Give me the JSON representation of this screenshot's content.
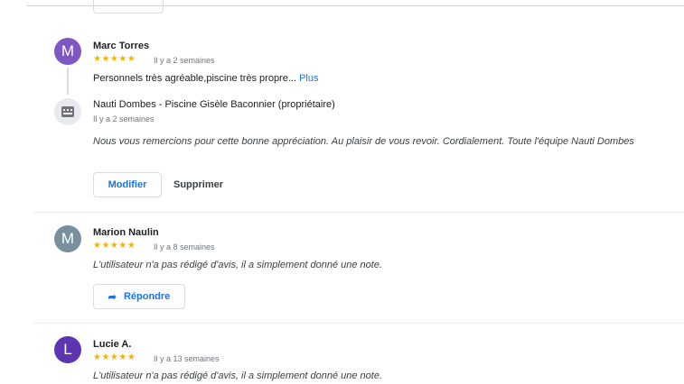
{
  "reviews": [
    {
      "initial": "M",
      "avatar_color": "#7e57c2",
      "name": "Marc Torres",
      "stars": "★★★★★",
      "age": "Il y a 2 semaines",
      "text": "Personnels très agréable,piscine très propre...",
      "more_label": "Plus",
      "owner_reply": {
        "name": "Nauti Dombes - Piscine Gisèle Baconnier (propriétaire)",
        "age": "Il y a 2 semaines",
        "text": "Nous vous remercions pour cette bonne appréciation. Au plaisir de vous revoir. Cordialement. Toute l'équipe Nauti Dombes"
      },
      "edit_label": "Modifier",
      "delete_label": "Supprimer"
    },
    {
      "initial": "M",
      "avatar_color": "#78909c",
      "name": "Marion Naulin",
      "stars": "★★★★★",
      "age": "Il y a 8 semaines",
      "text": "L'utilisateur n'a pas rédigé d'avis, il a simplement donné une note.",
      "reply_label": "Répondre"
    },
    {
      "initial": "L",
      "avatar_color": "#5e35b1",
      "name": "Lucie A.",
      "stars": "★★★★★",
      "age": "Il y a 13 semaines",
      "text": "L'utilisateur n'a pas rédigé d'avis, il a simplement donné une note."
    }
  ],
  "colors": {
    "accent": "#1a73e8",
    "star": "#f4b400"
  },
  "icons": {
    "owner": "storefront-icon",
    "reply": "reply-arrow-icon"
  }
}
